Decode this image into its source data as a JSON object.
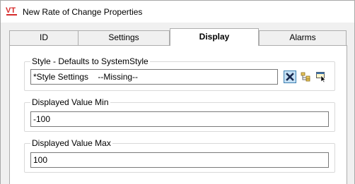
{
  "window": {
    "title": "New Rate of Change Properties",
    "icon": "vt-logo-icon"
  },
  "tabs": [
    {
      "label": "ID",
      "active": false
    },
    {
      "label": "Settings",
      "active": false
    },
    {
      "label": "Display",
      "active": true
    },
    {
      "label": "Alarms",
      "active": false
    }
  ],
  "display": {
    "style": {
      "label": "Style - Defaults to SystemStyle",
      "value": "*Style Settings    --Missing--",
      "clear_icon": "clear-x-icon",
      "browse_icon": "tree-browse-icon",
      "select_icon": "select-pointer-icon"
    },
    "min": {
      "label": "Displayed Value Min",
      "value": "-100"
    },
    "max": {
      "label": "Displayed Value Max",
      "value": "100"
    }
  },
  "colors": {
    "logo_red": "#d62b2b",
    "active_tab": "#ffffff",
    "client_bg": "#f0f0f0",
    "icon_highlight": "#c5e1f5"
  }
}
